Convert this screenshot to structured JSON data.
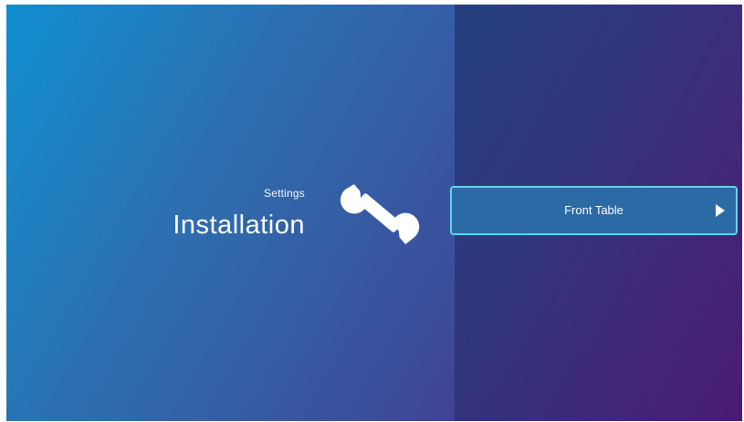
{
  "header": {
    "subtitle": "Settings",
    "title": "Installation",
    "icon": "wrench-icon"
  },
  "options": [
    {
      "label": "Front Table",
      "icon": "play-arrow-icon",
      "selected": true
    }
  ],
  "colors": {
    "accent_border": "#5fd6ea",
    "option_bg": "#2c6aa5",
    "bg_start": "#0f8fd0",
    "bg_end": "#4a1d78"
  }
}
